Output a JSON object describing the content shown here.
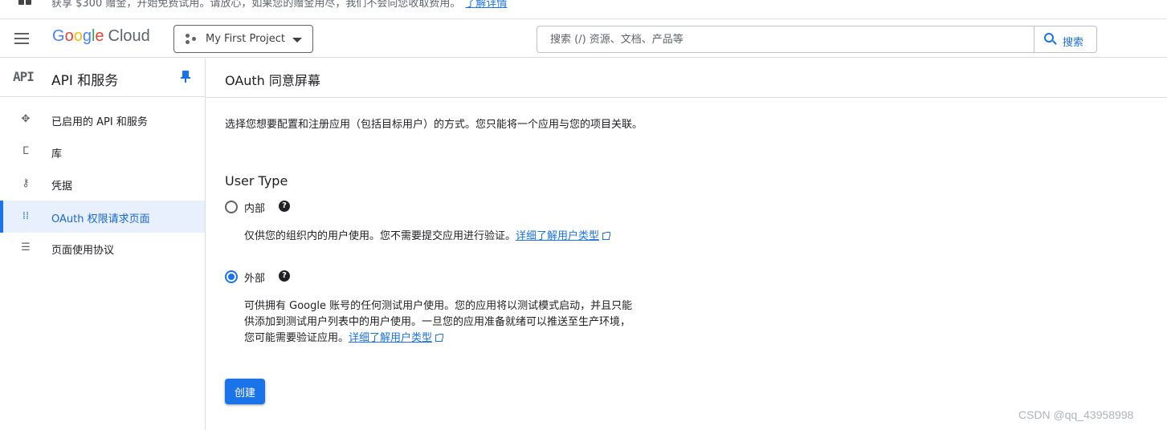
{
  "banner": {
    "text": "获享 $300 赠金，开始免费试用。请放心，如果您的赠金用尽，我们不会向您收取费用。",
    "link_label": "了解详情"
  },
  "header": {
    "logo_letters": [
      "G",
      "o",
      "o",
      "g",
      "l",
      "e"
    ],
    "logo_cloud": "Cloud",
    "project": "My First Project",
    "search_placeholder": "搜索 (/) 资源、文档、产品等",
    "search_button": "搜索"
  },
  "sidebar": {
    "badge": "API",
    "title": "API 和服务",
    "items": [
      {
        "label": "已启用的 API 和服务",
        "icon": "api-services-icon"
      },
      {
        "label": "库",
        "icon": "library-icon"
      },
      {
        "label": "凭据",
        "icon": "key-icon"
      },
      {
        "label": "OAuth 权限请求页面",
        "icon": "oauth-consent-icon",
        "active": true
      },
      {
        "label": "页面使用协议",
        "icon": "page-agreements-icon"
      }
    ]
  },
  "main": {
    "title": "OAuth 同意屏幕",
    "intro": "选择您想要配置和注册应用（包括目标用户）的方式。您只能将一个应用与您的项目关联。",
    "section_title": "User Type",
    "options": [
      {
        "label": "内部",
        "checked": false,
        "description": "仅供您的组织内的用户使用。您不需要提交应用进行验证。",
        "link": "详细了解用户类型"
      },
      {
        "label": "外部",
        "checked": true,
        "description": "可供拥有 Google 账号的任何测试用户使用。您的应用将以测试模式启动，并且只能供添加到测试用户列表中的用户使用。一旦您的应用准备就绪可以推送至生产环境，您可能需要验证应用。",
        "link": "详细了解用户类型"
      }
    ],
    "create_button": "创建"
  },
  "watermark": "CSDN @qq_43958998",
  "colors": {
    "accent": "#1a73e8",
    "active_bg": "#e8f0fe",
    "text": "#202124",
    "secondary": "#5f6368"
  }
}
